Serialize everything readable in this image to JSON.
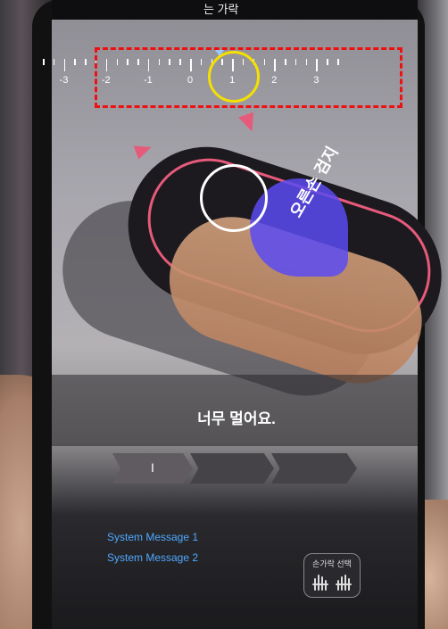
{
  "window": {
    "title_fragment": "는 가락"
  },
  "ruler": {
    "tick_labels": [
      "-3",
      "-2",
      "-1",
      "0",
      "1",
      "2",
      "3"
    ],
    "current_position": 0.7,
    "indicator_color": "#9ac8ff"
  },
  "annotation": {
    "dashed_box_color": "#ee1111",
    "highlight_circle_color": "#f5e000"
  },
  "guide": {
    "finger_label": "오른손 검지",
    "outline_color": "#e65a7b",
    "target_color": "#5a4bf2"
  },
  "message": {
    "text": "너무 멀어요."
  },
  "progress": {
    "steps": [
      "I",
      "",
      ""
    ],
    "completed": 1
  },
  "system_messages": [
    "System Message 1",
    "System Message 2"
  ],
  "finger_select": {
    "label": "손가락 선택",
    "icon": "hands-icon"
  }
}
